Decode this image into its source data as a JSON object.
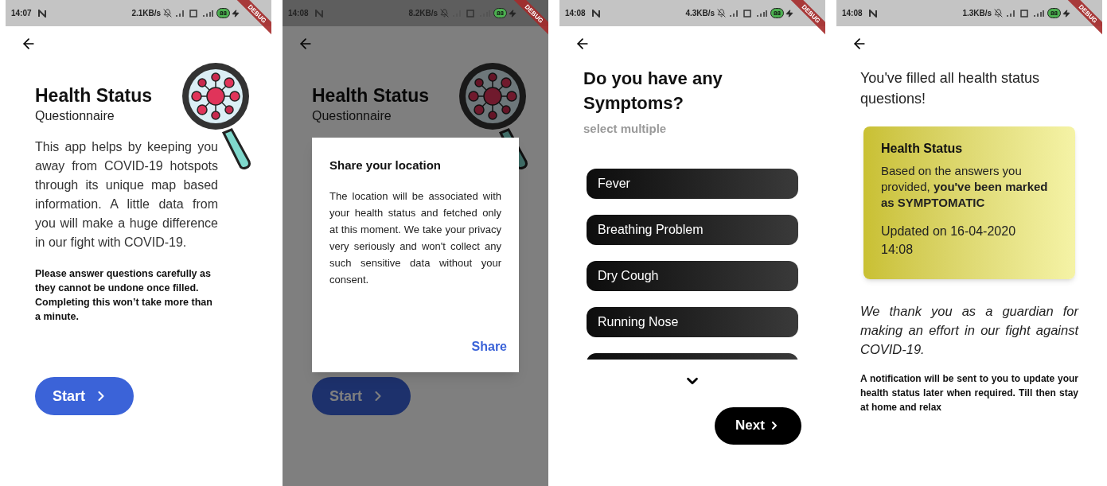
{
  "screens": [
    {
      "kind": "intro",
      "dimmed": false,
      "status": {
        "time": "14:07",
        "speed": "2.1KB/s",
        "battery": "88"
      },
      "debug_banner": "DEBUG",
      "title": "Health Status",
      "subtitle": "Questionnaire",
      "description": "This app helps by keeping you away from COVID-19 hotspots through its unique map based information. A little data from you will make a huge difference in our fight with COVID-19.",
      "note": "Please answer questions carefully as they cannot be undone once filled. Completing this won’t take more than a minute.",
      "start_button": "Start"
    },
    {
      "kind": "intro",
      "dimmed": true,
      "status": {
        "time": "14:08",
        "speed": "8.2KB/s",
        "battery": "88"
      },
      "debug_banner": "DEBUG",
      "title": "Health Status",
      "subtitle": "Questionnaire",
      "start_button": "Start",
      "dialog": {
        "title": "Share your location",
        "body": "The location will be associated with your health status and fetched only at this moment. We take your privacy very seriously and won't collect any such sensitive data without your consent.",
        "action": "Share"
      }
    },
    {
      "kind": "symptoms",
      "status": {
        "time": "14:08",
        "speed": "4.3KB/s",
        "battery": "88"
      },
      "debug_banner": "DEBUG",
      "title": "Do you have any Symptoms?",
      "hint": "select multiple",
      "options": [
        {
          "label": "Fever",
          "selected": false
        },
        {
          "label": "Breathing Problem",
          "selected": false
        },
        {
          "label": "Dry Cough",
          "selected": false
        },
        {
          "label": "Running Nose",
          "selected": false
        }
      ],
      "next_button": "Next"
    },
    {
      "kind": "result",
      "status": {
        "time": "14:08",
        "speed": "1.3KB/s",
        "battery": "88"
      },
      "debug_banner": "DEBUG",
      "message": "You've filled all health status questions!",
      "card": {
        "title": "Health Status",
        "body": "Based on the answers you provided, **you've been marked as SYMPTOMATIC**",
        "updated": "Updated on 16-04-2020 14:08"
      },
      "thanks": "We thank you as a guardian for making an effort in our fight against COVID-19.",
      "notification": "A notification will be sent to you to update your health status later when required. Till then stay at home and relax"
    }
  ]
}
